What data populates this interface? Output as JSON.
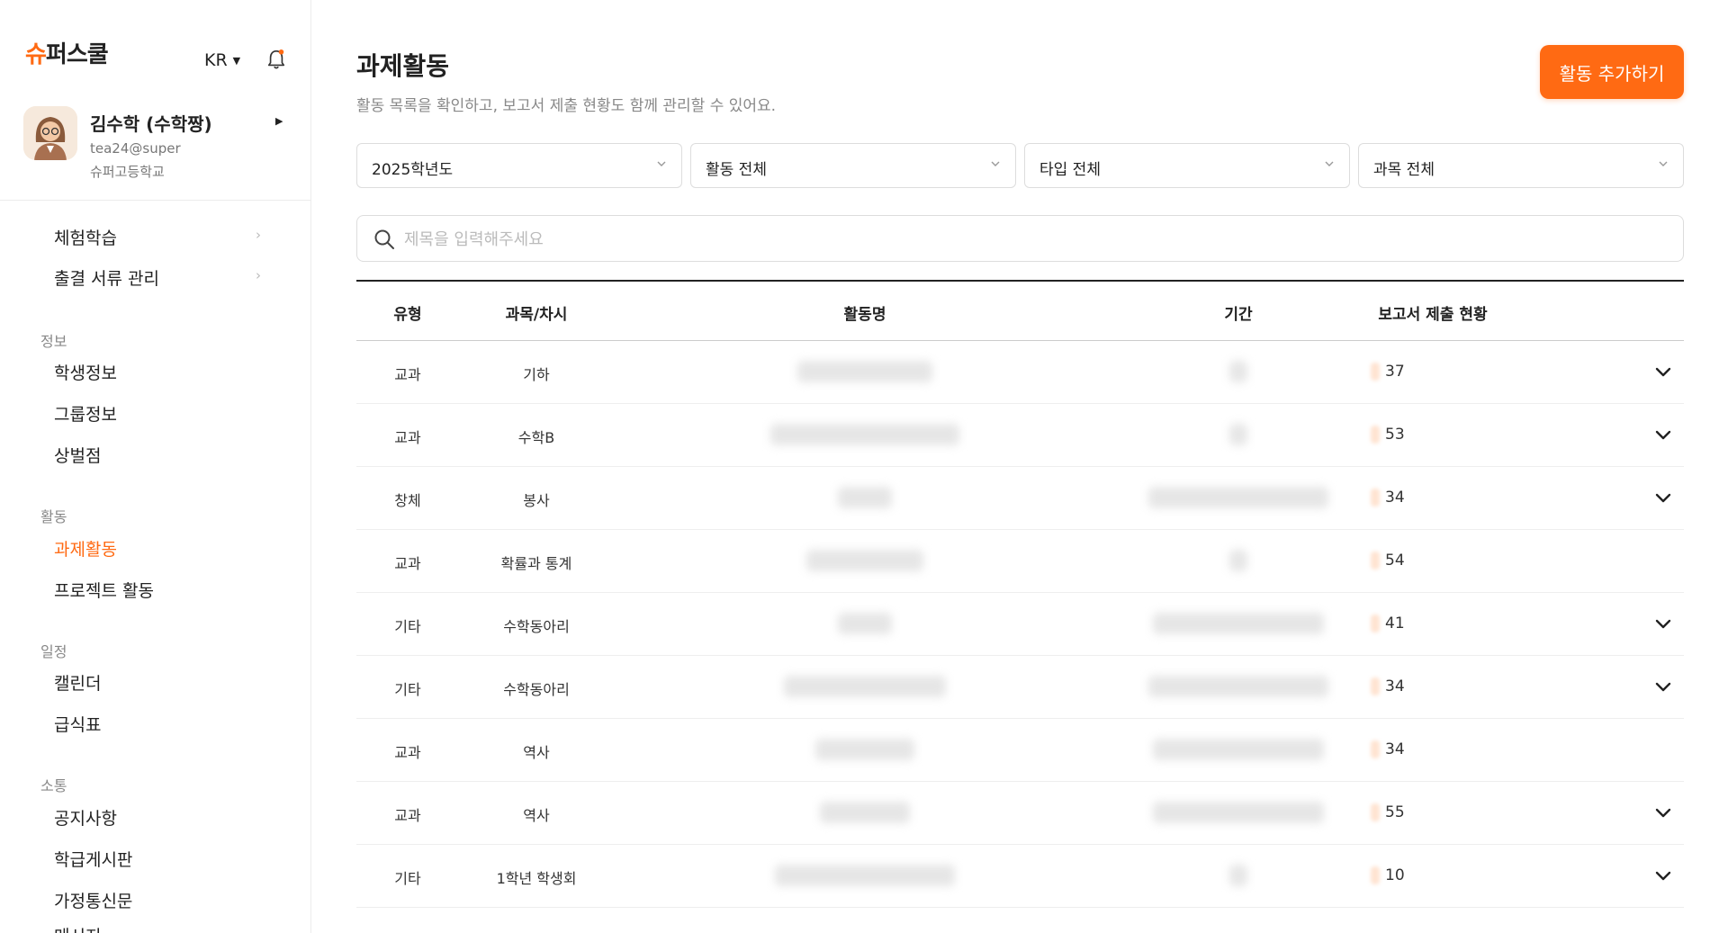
{
  "brand": {
    "logo_pre": "슈",
    "logo_main": "퍼스쿨",
    "accent": "#ff6a13"
  },
  "lang": {
    "label": "KR"
  },
  "profile": {
    "name": "김수학 (수학짱)",
    "email": "tea24@super",
    "school": "슈퍼고등학교"
  },
  "nav": {
    "items_top": [
      {
        "label": "체험학습"
      },
      {
        "label": "출결 서류 관리"
      }
    ],
    "sec_info": "정보",
    "items_info": [
      {
        "label": "학생정보"
      },
      {
        "label": "그룹정보"
      },
      {
        "label": "상벌점"
      }
    ],
    "sec_activity": "활동",
    "items_activity": [
      {
        "label": "과제활동"
      },
      {
        "label": "프로젝트 활동"
      }
    ],
    "sec_schedule": "일정",
    "items_schedule": [
      {
        "label": "캘린더"
      },
      {
        "label": "급식표"
      }
    ],
    "sec_comm": "소통",
    "items_comm": [
      {
        "label": "공지사항"
      },
      {
        "label": "학급게시판"
      },
      {
        "label": "가정통신문"
      },
      {
        "label": "메시지"
      }
    ]
  },
  "page": {
    "title": "과제활동",
    "subtitle": "활동 목록을 확인하고, 보고서 제출 현황도 함께 관리할 수 있어요.",
    "add_button": "활동 추가하기"
  },
  "filters": [
    {
      "value": "2025학년도"
    },
    {
      "value": "활동 전체"
    },
    {
      "value": "타입 전체"
    },
    {
      "value": "과목 전체"
    }
  ],
  "search": {
    "placeholder": "제목을 입력해주세요"
  },
  "table": {
    "headers": {
      "type": "유형",
      "subject": "과목/차시",
      "name": "활동명",
      "period": "기간",
      "report": "보고서 제출 현황"
    },
    "rows": [
      {
        "type": "교과",
        "subject": "기하",
        "count": "37",
        "expandable": true
      },
      {
        "type": "교과",
        "subject": "수학B",
        "count": "53",
        "expandable": true
      },
      {
        "type": "창체",
        "subject": "봉사",
        "count": "34",
        "expandable": true
      },
      {
        "type": "교과",
        "subject": "확률과 통계",
        "count": "54",
        "expandable": false
      },
      {
        "type": "기타",
        "subject": "수학동아리",
        "count": "41",
        "expandable": true
      },
      {
        "type": "기타",
        "subject": "수학동아리",
        "count": "34",
        "expandable": true
      },
      {
        "type": "교과",
        "subject": "역사",
        "count": "34",
        "expandable": false
      },
      {
        "type": "교과",
        "subject": "역사",
        "count": "55",
        "expandable": true
      },
      {
        "type": "기타",
        "subject": "1학년 학생회",
        "count": "10",
        "expandable": true
      }
    ]
  }
}
